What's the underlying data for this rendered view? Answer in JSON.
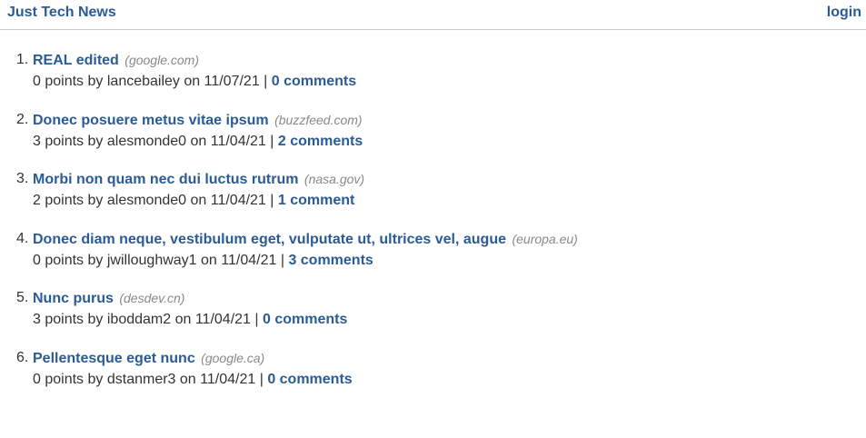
{
  "header": {
    "brand": "Just Tech News",
    "login_label": "login"
  },
  "posts": [
    {
      "num": "1.",
      "title": "REAL edited",
      "domain": "(google.com)",
      "points": "0",
      "points_label": "points by",
      "user": "lancebailey",
      "date": "11/07/21",
      "comments": "0 comments"
    },
    {
      "num": "2.",
      "title": "Donec posuere metus vitae ipsum",
      "domain": "(buzzfeed.com)",
      "points": "3",
      "points_label": "points by",
      "user": "alesmonde0",
      "date": "11/04/21",
      "comments": "2 comments"
    },
    {
      "num": "3.",
      "title": "Morbi non quam nec dui luctus rutrum",
      "domain": "(nasa.gov)",
      "points": "2",
      "points_label": "points by",
      "user": "alesmonde0",
      "date": "11/04/21",
      "comments": "1 comment"
    },
    {
      "num": "4.",
      "title": "Donec diam neque, vestibulum eget, vulputate ut, ultrices vel, augue",
      "domain": "(europa.eu)",
      "points": "0",
      "points_label": "points by",
      "user": "jwilloughway1",
      "date": "11/04/21",
      "comments": "3 comments"
    },
    {
      "num": "5.",
      "title": "Nunc purus",
      "domain": "(desdev.cn)",
      "points": "3",
      "points_label": "points by",
      "user": "iboddam2",
      "date": "11/04/21",
      "comments": "0 comments"
    },
    {
      "num": "6.",
      "title": "Pellentesque eget nunc",
      "domain": "(google.ca)",
      "points": "0",
      "points_label": "points by",
      "user": "dstanmer3",
      "date": "11/04/21",
      "comments": "0 comments"
    }
  ],
  "labels": {
    "on": "on",
    "separator": "|"
  }
}
